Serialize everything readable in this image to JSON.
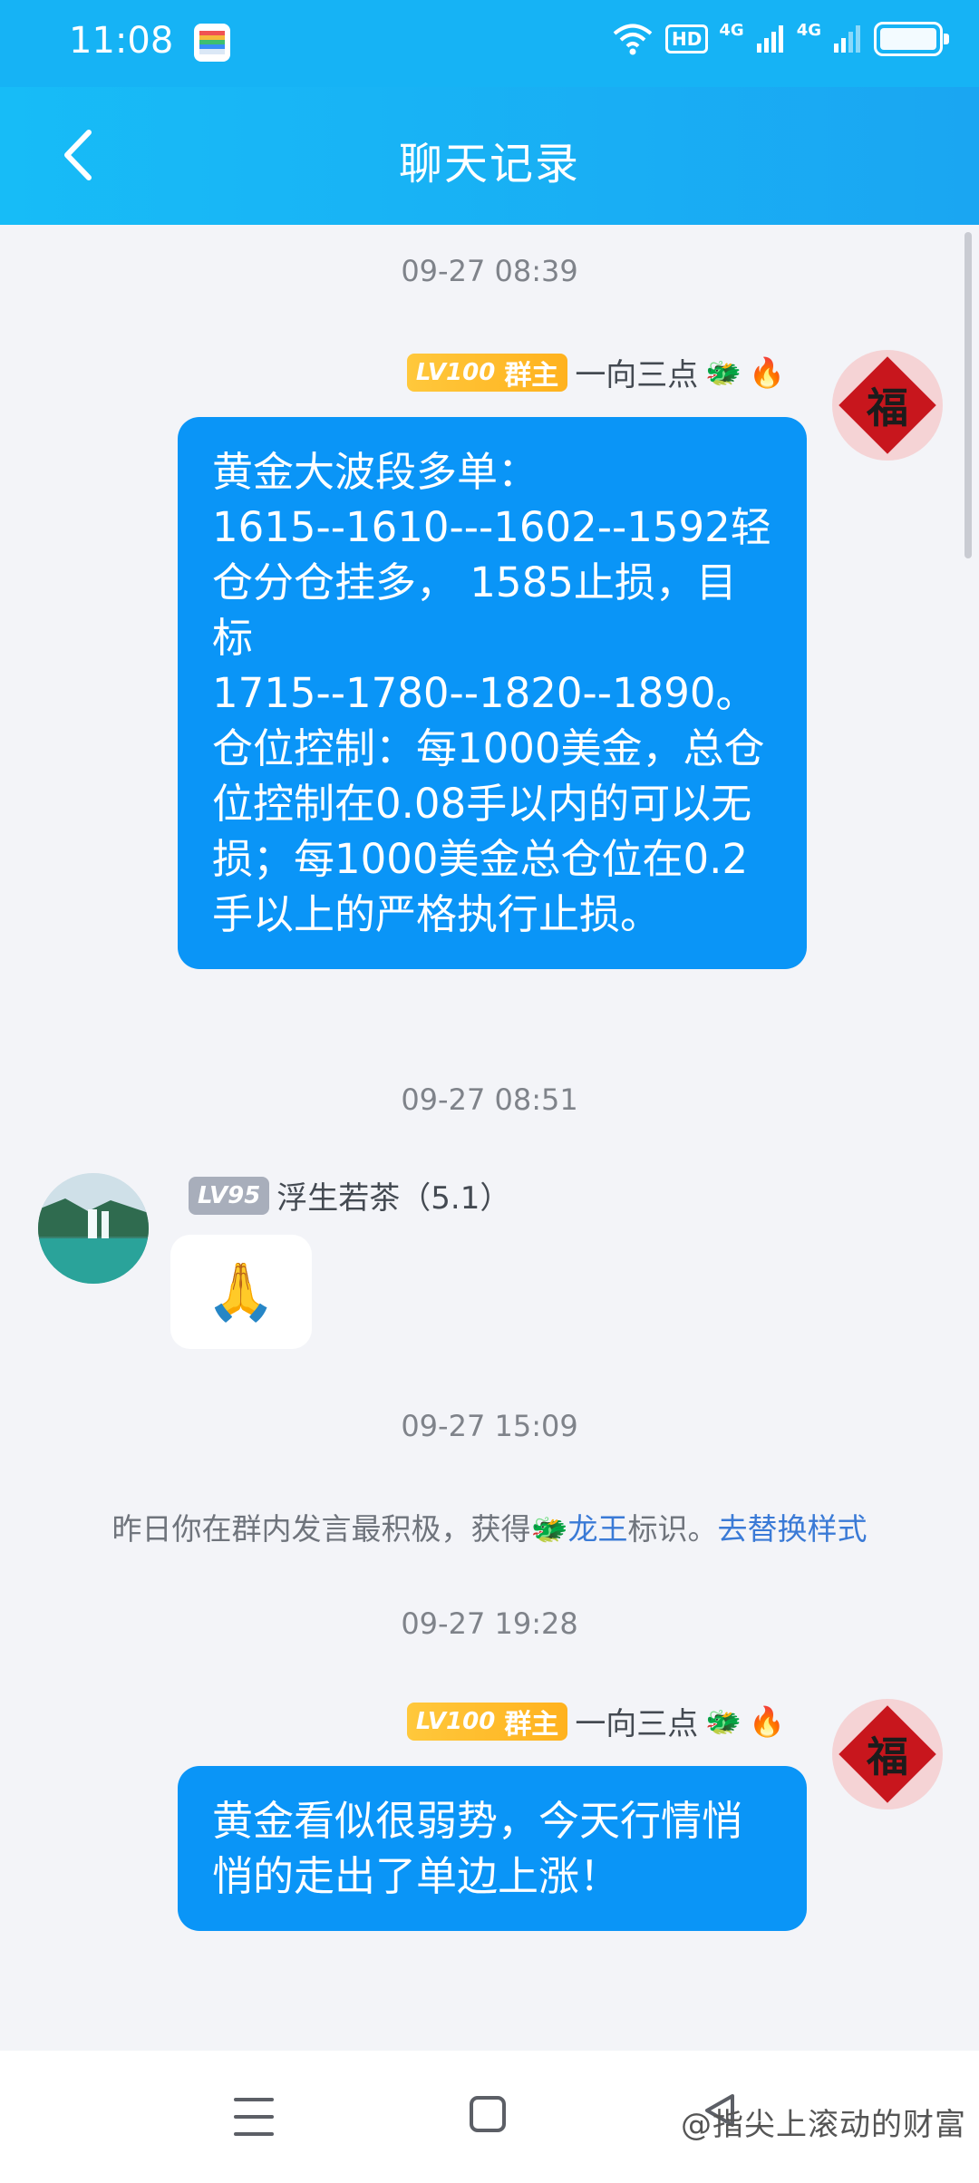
{
  "status_bar": {
    "time": "11:08",
    "hd_label": "HD",
    "network_1": "4G",
    "network_2": "4G"
  },
  "header": {
    "title": "聊天记录",
    "back_icon": "chevron-left-icon"
  },
  "messages": [
    {
      "timestamp": "09-27 08:39",
      "level": "LV100",
      "role": "群主",
      "name": "一向三点",
      "badges": [
        "🐲",
        "🔥"
      ],
      "avatar": "fu-avatar",
      "avatar_char": "福",
      "text": "黄金大波段多单：\n1615--1610---1602--1592轻仓分仓挂多， 1585止损，目标\n1715--1780--1820--1890。仓位控制：每1000美金，总仓位控制在0.08手以内的可以无损；每1000美金总仓位在0.2手以上的严格执行止损。"
    },
    {
      "timestamp": "09-27 08:51",
      "level": "LV95",
      "name": "浮生若茶（5.1）",
      "avatar": "landscape-avatar",
      "content": "🙏"
    },
    {
      "timestamp": "09-27 15:09",
      "system_text": "昨日你在群内发言最积极，获得🐲",
      "system_link_1": "龙王",
      "system_text_2": "标识。",
      "system_link_2": "去替换样式"
    },
    {
      "timestamp": "09-27 19:28",
      "level": "LV100",
      "role": "群主",
      "name": "一向三点",
      "badges": [
        "🐲",
        "🔥"
      ],
      "avatar": "fu-avatar",
      "avatar_char": "福",
      "text": "黄金看似很弱势，今天行情悄悄的走出了单边上涨！"
    }
  ],
  "nav": {
    "watermark": "@指尖上滚动的财富"
  },
  "colors": {
    "header": "#16b3f5",
    "my_bubble": "#0a95f7",
    "level_gold": "#ffb21e",
    "link": "#3a7ad6"
  }
}
